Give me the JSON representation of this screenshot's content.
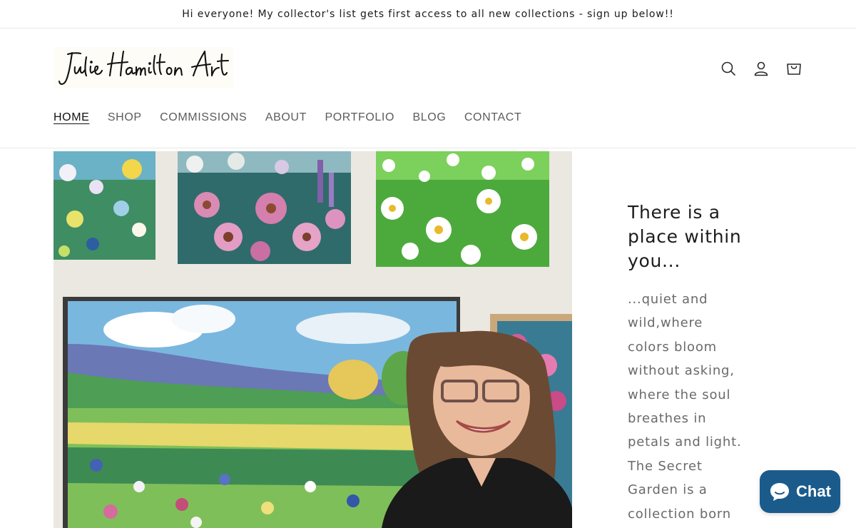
{
  "announcement": {
    "text": "Hi everyone! My collector's list gets first access to all new collections - sign up below!!"
  },
  "header": {
    "logo_text": "Julie Hamilton Art",
    "icons": {
      "search": "search-icon",
      "account": "account-icon",
      "cart": "cart-icon"
    }
  },
  "nav": {
    "items": [
      {
        "label": "HOME",
        "active": true
      },
      {
        "label": "SHOP"
      },
      {
        "label": "COMMISSIONS"
      },
      {
        "label": "ABOUT"
      },
      {
        "label": "PORTFOLIO"
      },
      {
        "label": "BLOG"
      },
      {
        "label": "CONTACT"
      }
    ]
  },
  "hero": {
    "heading": "There is a place within you...",
    "body": "...quiet and wild,where colors bloom without asking, where the soul breathes in petals and light. The Secret Garden is a collection born from that inner"
  },
  "chat": {
    "label": "Chat",
    "icon": "chat-bubble-icon",
    "color": "#1b5b8c"
  }
}
